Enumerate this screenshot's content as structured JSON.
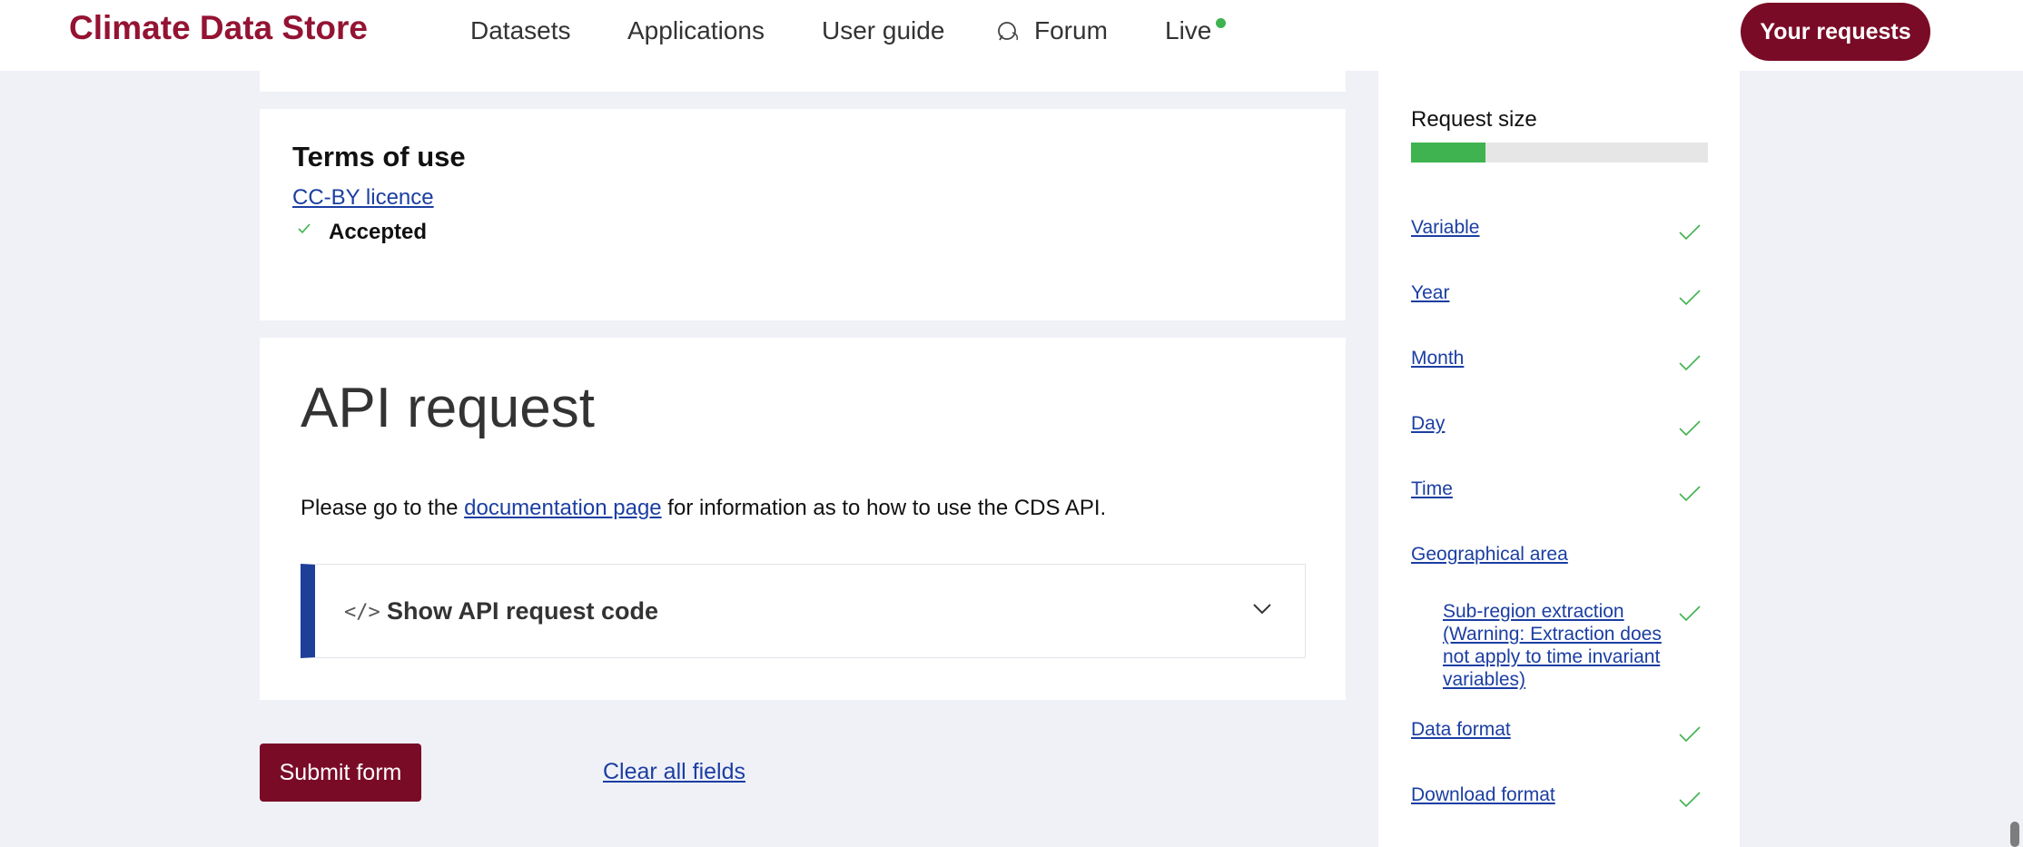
{
  "header": {
    "brand": "Climate Data Store",
    "nav": [
      "Datasets",
      "Applications",
      "User guide",
      "Forum",
      "Live"
    ],
    "your_requests": "Your requests"
  },
  "terms": {
    "title": "Terms of use",
    "licence_link": "CC-BY licence",
    "status": "Accepted"
  },
  "api": {
    "title": "API request",
    "desc_before": "Please go to the ",
    "desc_link": "documentation page",
    "desc_after": " for information as to how to use the CDS API.",
    "toggle_label": "Show API request code",
    "code_icon": "</>"
  },
  "actions": {
    "submit": "Submit form",
    "clear": "Clear all fields"
  },
  "sidebar": {
    "request_size_label": "Request size",
    "request_size_fraction": 0.25,
    "items": [
      {
        "label": "Variable",
        "checked": true
      },
      {
        "label": "Year",
        "checked": true
      },
      {
        "label": "Month",
        "checked": true
      },
      {
        "label": "Day",
        "checked": true
      },
      {
        "label": "Time",
        "checked": true
      },
      {
        "label": "Geographical area",
        "checked": false
      },
      {
        "label": "Sub-region extraction (Warning: Extraction does not apply to time invariant variables)",
        "checked": true
      },
      {
        "label": "Data format",
        "checked": true
      },
      {
        "label": "Download format",
        "checked": true
      }
    ]
  },
  "colors": {
    "brand": "#941333",
    "button": "#7a0b27",
    "link": "#1b3ea2",
    "check": "#3fb34f",
    "accent_bar": "#1e3f99"
  }
}
